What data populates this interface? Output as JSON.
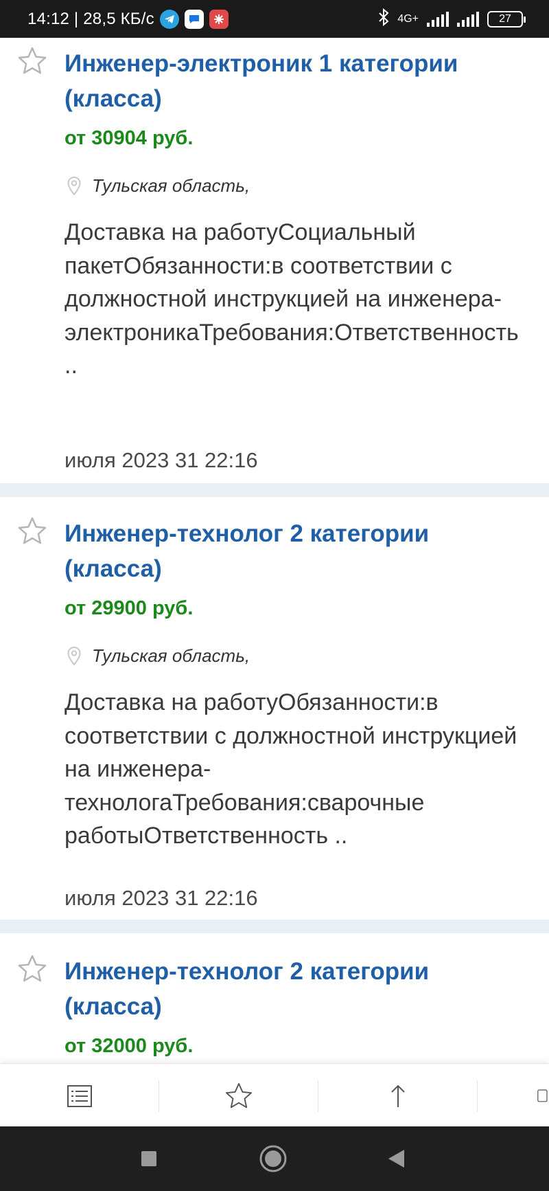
{
  "status_bar": {
    "time_speed": "14:12 | 28,5 КБ/с",
    "network_type": "4G+",
    "battery": "27",
    "icons": [
      "telegram-icon",
      "messages-icon",
      "snowflake-app-icon",
      "bluetooth-icon",
      "signal-icon",
      "battery-icon"
    ]
  },
  "listings": [
    {
      "title": "Инженер-электроник 1 категории (класса)",
      "salary": "от 30904 руб.",
      "location": "Тульская область,",
      "description": "Доставка на работуСоциальный пакетОбязанности:в соответствии с должностной инструкцией на инженера-электроникаТребования:Ответственность ..",
      "date": "июля 2023 31 22:16"
    },
    {
      "title": "Инженер-технолог 2 категории (класса)",
      "salary": "от 29900 руб.",
      "location": "Тульская область,",
      "description": "Доставка на работуОбязанности:в соответствии с должностной инструкцией на инженера-технологаТребования:сварочные работыОтветственность ..",
      "date": "июля 2023 31 22:16"
    },
    {
      "title": "Инженер-технолог 2 категории (класса)",
      "salary": "от 32000 руб."
    }
  ],
  "toolbar": {
    "icons": [
      "list-icon",
      "favorites-star-icon",
      "scroll-top-arrow-icon",
      "copy-icon"
    ]
  },
  "navbar": {
    "icons": [
      "recents-square-icon",
      "home-circle-icon",
      "back-triangle-icon"
    ]
  },
  "colors": {
    "title": "#1f5fa8",
    "salary": "#1b8a1b",
    "divider": "#e9f1f7",
    "status_bar": "#1a1a1a",
    "nav_bar": "#1f1f1f"
  }
}
